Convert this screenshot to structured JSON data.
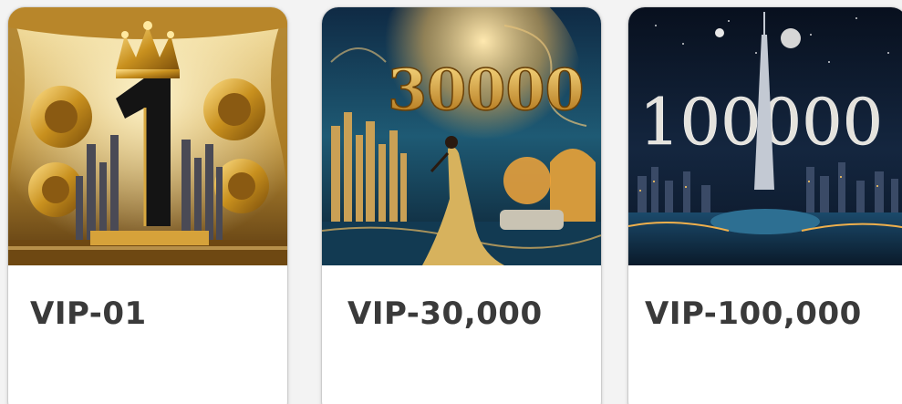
{
  "cards": [
    {
      "label": "VIP-01",
      "image_text": "1",
      "image_icon": "golden-crown-lions-city-image"
    },
    {
      "label": "VIP-30,000",
      "image_text": "30000",
      "image_icon": "golden-city-lady-image"
    },
    {
      "label": "VIP-100,000",
      "image_text": "100000",
      "image_icon": "night-skyline-tower-image"
    }
  ],
  "colors": {
    "card_bg": "#ffffff",
    "label_text": "#3a3a3a",
    "page_bg": "#f3f3f3"
  }
}
